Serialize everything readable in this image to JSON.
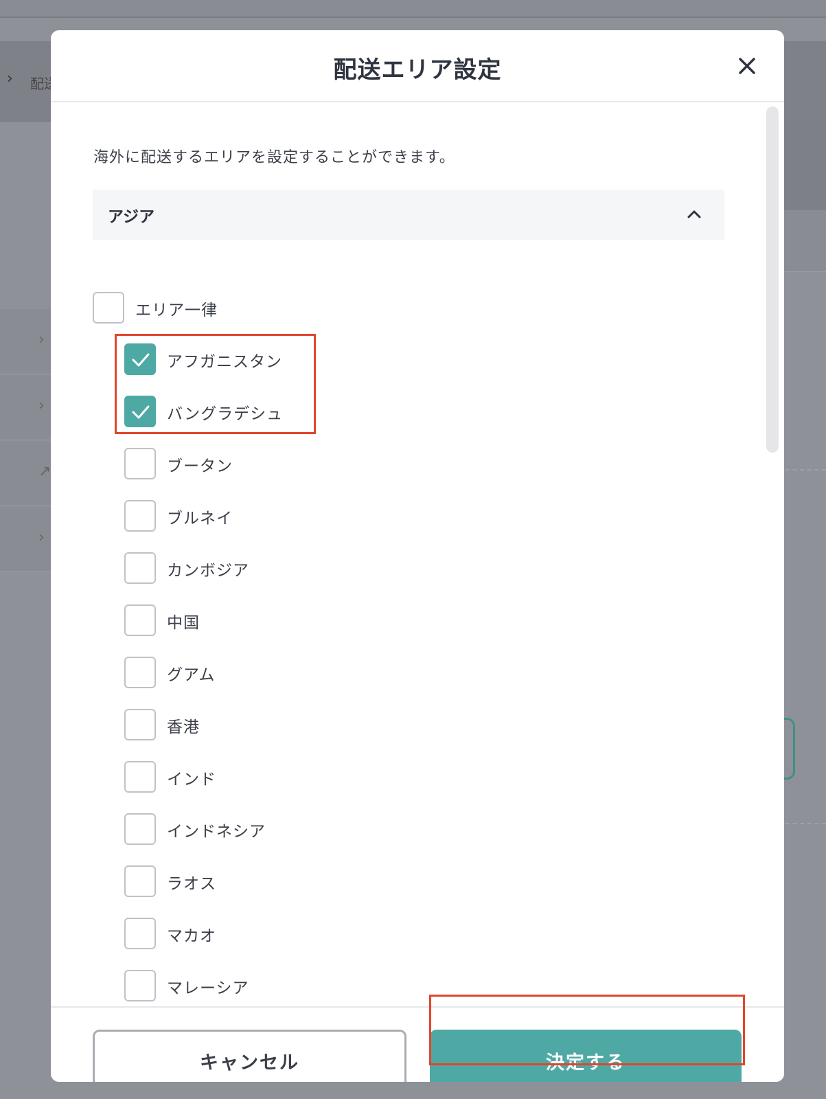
{
  "background": {
    "breadcrumb_text": "配送"
  },
  "modal": {
    "title": "配送エリア設定",
    "close_icon": "close-icon",
    "description": "海外に配送するエリアを設定することができます。",
    "group": {
      "label": "アジア",
      "expanded": true
    },
    "area_uniform_label": "エリア一律",
    "area_uniform_checked": false,
    "countries": [
      {
        "label": "アフガニスタン",
        "checked": true
      },
      {
        "label": "バングラデシュ",
        "checked": true
      },
      {
        "label": "ブータン",
        "checked": false
      },
      {
        "label": "ブルネイ",
        "checked": false
      },
      {
        "label": "カンボジア",
        "checked": false
      },
      {
        "label": "中国",
        "checked": false
      },
      {
        "label": "グアム",
        "checked": false
      },
      {
        "label": "香港",
        "checked": false
      },
      {
        "label": "インド",
        "checked": false
      },
      {
        "label": "インドネシア",
        "checked": false
      },
      {
        "label": "ラオス",
        "checked": false
      },
      {
        "label": "マカオ",
        "checked": false
      },
      {
        "label": "マレーシア",
        "checked": false
      }
    ],
    "cancel_label": "キャンセル",
    "confirm_label": "決定する"
  },
  "colors": {
    "accent": "#4ea9a5",
    "highlight": "#e2452c",
    "overlay": "#8f9198"
  }
}
